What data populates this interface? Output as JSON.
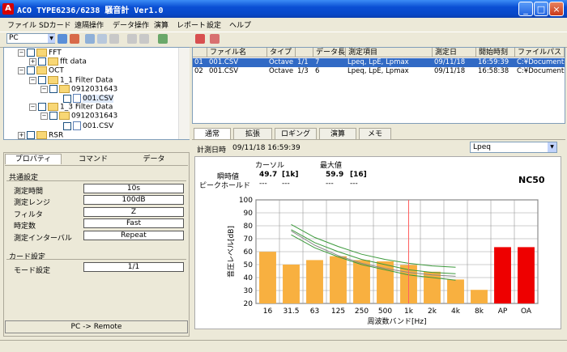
{
  "window": {
    "title": "ACO TYPE6236/6238 騒音計 Ver1.0"
  },
  "menu": [
    "ファイル",
    "SDカード",
    "遠隔操作",
    "データ操作",
    "演算",
    "レポート",
    "設定",
    "ヘルプ"
  ],
  "toolbar": {
    "device_select": "PC"
  },
  "tree": [
    {
      "label": "FFT",
      "level": 2,
      "kind": "folder",
      "expander": "−"
    },
    {
      "label": "fft data",
      "level": 3,
      "kind": "folder",
      "expander": "+"
    },
    {
      "label": "OCT",
      "level": 2,
      "kind": "folder",
      "expander": "−"
    },
    {
      "label": "1_1 Filter Data",
      "level": 3,
      "kind": "folder",
      "expander": "−"
    },
    {
      "label": "0912031643",
      "level": 4,
      "kind": "folder",
      "expander": "−"
    },
    {
      "label": "001.CSV",
      "level": 5,
      "kind": "file",
      "expander": ""
    },
    {
      "label": "1_3 Filter Data",
      "level": 3,
      "kind": "folder",
      "expander": "−"
    },
    {
      "label": "0912031643",
      "level": 4,
      "kind": "folder",
      "expander": "−"
    },
    {
      "label": "001.CSV",
      "level": 5,
      "kind": "file",
      "expander": ""
    },
    {
      "label": "RSR",
      "level": 2,
      "kind": "folder",
      "expander": "+"
    }
  ],
  "prop_tabs": [
    "プロパティ",
    "コマンド",
    "データ"
  ],
  "common_settings": {
    "title": "共通設定",
    "rows": [
      {
        "label": "測定時間",
        "value": "10s"
      },
      {
        "label": "測定レンジ",
        "value": "100dB"
      },
      {
        "label": "フィルタ",
        "value": "Z"
      },
      {
        "label": "時定数",
        "value": "Fast"
      },
      {
        "label": "測定インターバル",
        "value": "Repeat"
      }
    ]
  },
  "card_settings": {
    "title": "カード設定",
    "rows": [
      {
        "label": "モード設定",
        "value": "1/1"
      }
    ]
  },
  "pc_remote_label": "PC -> Remote",
  "list": {
    "headers": [
      "",
      "ファイル名",
      "タイプ",
      "",
      "データ長",
      "測定項目",
      "測定日",
      "開始時刻",
      "ファイルパス"
    ],
    "rows": [
      [
        "01",
        "001.CSV",
        "Octave",
        "1/1",
        "7",
        "Lpeq, LpE, Lpmax",
        "09/11/18",
        "16:59:39",
        "C:¥Documents a"
      ],
      [
        "02",
        "001.CSV",
        "Octave",
        "1/3",
        "6",
        "Lpeq, LpE, Lpmax",
        "09/11/18",
        "16:58:38",
        "C:¥Documents a"
      ]
    ]
  },
  "chart_tabs": [
    "通常",
    "拡張",
    "ロギング",
    "演算",
    "メモ"
  ],
  "measure_datetime_label": "計測日時",
  "measure_datetime_value": "09/11/18 16:59:39",
  "mode_select": "Lpeq",
  "readout": {
    "cursor_label": "カーソル",
    "max_label": "最大値",
    "instant_label": "瞬時値",
    "peak_label": "ピークホールド",
    "cursor_value": "49.7",
    "cursor_band": "[1k]",
    "max_value": "59.9",
    "max_band": "[16]",
    "peak_cursor_value": "---",
    "peak_cursor_band": "---",
    "peak_max_value": "---",
    "peak_max_band": "---",
    "nc_label": "NC50"
  },
  "chart_data": {
    "type": "bar",
    "categories": [
      "16",
      "31.5",
      "63",
      "125",
      "250",
      "500",
      "1k",
      "2k",
      "4k",
      "8k",
      "AP",
      "OA"
    ],
    "values": [
      59.9,
      50.0,
      53.5,
      56.5,
      53.5,
      52.5,
      49.7,
      44.5,
      38.5,
      30.5,
      63.5,
      63.5
    ],
    "bar_colors": [
      "#f8b040",
      "#f8b040",
      "#f8b040",
      "#f8b040",
      "#f8b040",
      "#f8b040",
      "#f8b040",
      "#f8b040",
      "#f8b040",
      "#f8b040",
      "#ee0000",
      "#ee0000"
    ],
    "xlabel": "周波数バンド[Hz]",
    "ylabel": "音圧レベル[dB]",
    "ylim": [
      20,
      100
    ],
    "yticks": [
      20,
      30,
      40,
      50,
      60,
      70,
      80,
      90,
      100
    ],
    "cursor_category": "1k",
    "nc_curves": [
      {
        "color": "#3c9a3c",
        "values": [
          null,
          81,
          71,
          64,
          58,
          54,
          51,
          49,
          48,
          null
        ]
      },
      {
        "color": "#3c9a3c",
        "values": [
          null,
          77,
          67,
          60,
          54,
          50,
          46,
          44,
          43,
          null
        ]
      },
      {
        "color": "#888888",
        "values": [
          null,
          76,
          65,
          57,
          51,
          47,
          44,
          42,
          41,
          null
        ]
      },
      {
        "color": "#3c9a3c",
        "values": [
          null,
          73,
          63,
          56,
          50,
          46,
          42,
          40,
          38,
          null
        ]
      }
    ],
    "grid": true
  },
  "colors": {
    "title_blue": "#0a4fd4",
    "bar_orange": "#f8b040",
    "bar_red": "#ee0000",
    "cursor_red": "#ff6060"
  }
}
